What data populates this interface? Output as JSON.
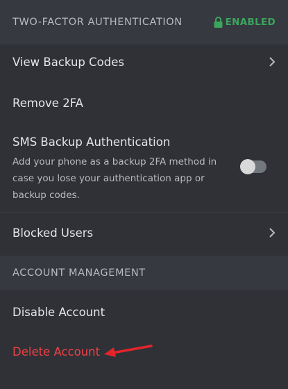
{
  "two_factor": {
    "title": "TWO-FACTOR AUTHENTICATION",
    "status": "ENABLED",
    "status_color": "#3ba55d",
    "status_icon": "lock-icon",
    "items": [
      {
        "label": "View Backup Codes",
        "icon": "chevron-right-icon"
      },
      {
        "label": "Remove 2FA"
      }
    ],
    "sms": {
      "title": "SMS Backup Authentication",
      "description": "Add your phone as a backup 2FA method in case you lose your authentication app or backup codes.",
      "toggle_on": false
    }
  },
  "blocked_users": {
    "label": "Blocked Users",
    "icon": "chevron-right-icon"
  },
  "account_management": {
    "title": "ACCOUNT MANAGEMENT",
    "disable_label": "Disable Account",
    "delete_label": "Delete Account",
    "delete_color": "#ed4245",
    "annotation_icon": "red-arrow-icon"
  }
}
